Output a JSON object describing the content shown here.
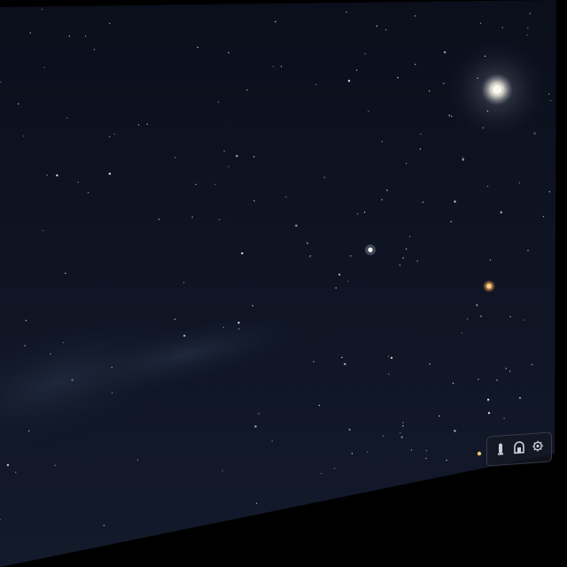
{
  "colors": {
    "sky_top": "#0b0f1c",
    "sky_bottom": "#121a2c",
    "milky_way": "#26324a",
    "outer_frame": "#000000",
    "moon": "#f4f1e6",
    "mars": "#f0a24a",
    "star": "#e9eef8"
  },
  "toolbar": {
    "buttons": [
      {
        "icon": "telescope-icon"
      },
      {
        "icon": "observatory-icon"
      },
      {
        "icon": "settings-gear-icon"
      }
    ]
  }
}
